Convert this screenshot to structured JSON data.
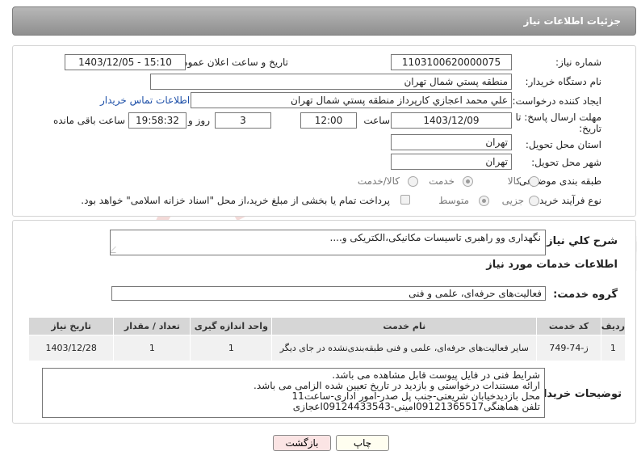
{
  "header": {
    "title": "جزئیات اطلاعات نیاز"
  },
  "form": {
    "need_number": {
      "label": "شماره نیاز:",
      "value": "1103100620000075"
    },
    "announce_datetime": {
      "label": "تاریخ و ساعت اعلان عمومی:",
      "value": "1403/12/05 - 15:10"
    },
    "buyer_org": {
      "label": "نام دستگاه خریدار:",
      "value": "منطقه پستي شمال تهران"
    },
    "requester": {
      "label": "ایجاد کننده درخواست:",
      "value": "علي محمد اعجازي کارپرداز منطقه پستي شمال تهران",
      "contact_link": "اطلاعات تماس خریدار"
    },
    "deadline": {
      "label_line1": "مهلت ارسال پاسخ: تا",
      "label_line2": "تاریخ:",
      "date": "1403/12/09",
      "time_label": "ساعت",
      "time": "12:00",
      "days": "3",
      "days_label": "روز و",
      "remaining": "19:58:32",
      "remaining_label": "ساعت باقی مانده"
    },
    "province": {
      "label": "استان محل تحویل:",
      "value": "تهران"
    },
    "city": {
      "label": "شهر محل تحویل:",
      "value": "تهران"
    },
    "category": {
      "label": "طبقه بندی موضوعی:",
      "options": [
        "کالا",
        "خدمت",
        "کالا/خدمت"
      ],
      "selected": "خدمت"
    },
    "process": {
      "label": "نوع فرآیند خرید :",
      "options": [
        "جزیی",
        "متوسط"
      ],
      "selected": "جزیی",
      "payment_note": "پرداخت تمام یا بخشی از مبلغ خرید،از محل \"اسناد خزانه اسلامی\" خواهد بود."
    }
  },
  "summary": {
    "label": "شرح کلي نياز:",
    "value": "نگهداری وو راهبری تاسیسات مکانیکی،الکتریکی و...."
  },
  "services_section": {
    "title": "اطلاعات خدمات مورد نیاز"
  },
  "service_group": {
    "label": "گروه خدمت:",
    "value": "فعالیت‌های حرفه‌ای، علمی و فنی"
  },
  "table": {
    "headers": [
      "ردیف",
      "کد خدمت",
      "نام خدمت",
      "واحد اندازه گیری",
      "تعداد / مقدار",
      "تاریخ نیاز"
    ],
    "rows": [
      [
        "1",
        "ز-74-749",
        "سایر فعالیت‌های حرفه‌ای، علمی و فنی طبقه‌بندی‌نشده در جای دیگر",
        "1",
        "1",
        "1403/12/28"
      ]
    ]
  },
  "buyer_notes": {
    "label": "توضیحات خریدار:",
    "lines": [
      "شرایط فنی در فایل پیوست قابل مشاهده می باشد.",
      "ارائه مستندات درخواستی و بازدید در تاریخ تعیین شده الزامی می باشد.",
      "محل بازدیدخیابان شریعتی-جنب پل صدر-امور اداری-ساعت11",
      "تلفن هماهنگی09121365517امینی-09124433543اعجازی"
    ]
  },
  "buttons": {
    "print": "چاپ",
    "back": "بازگشت"
  },
  "watermark": {
    "text": "AriaTender.neT"
  },
  "colors": {
    "header_bg": "#9e9e9e",
    "link": "#1d4fa8",
    "back_button": "#fbe4e4",
    "print_button": "#fffef0"
  }
}
